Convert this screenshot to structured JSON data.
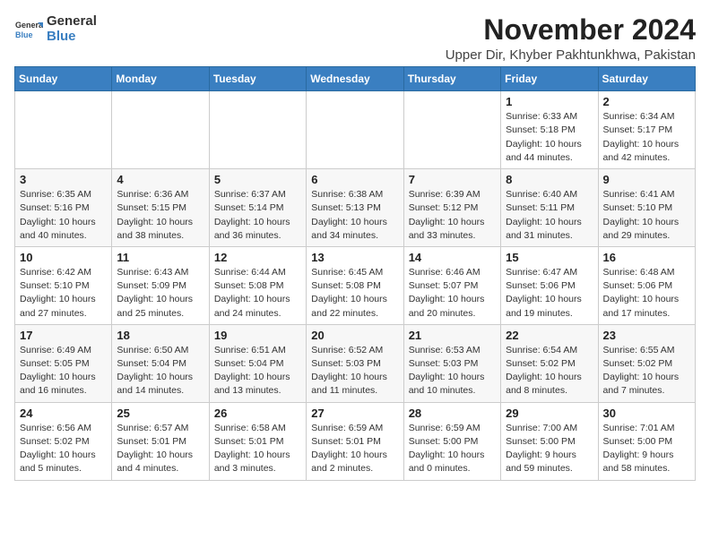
{
  "logo": {
    "name": "General Blue",
    "line1": "General",
    "line2": "Blue"
  },
  "header": {
    "month": "November 2024",
    "location": "Upper Dir, Khyber Pakhtunkhwa, Pakistan"
  },
  "weekdays": [
    "Sunday",
    "Monday",
    "Tuesday",
    "Wednesday",
    "Thursday",
    "Friday",
    "Saturday"
  ],
  "weeks": [
    [
      {
        "day": "",
        "info": ""
      },
      {
        "day": "",
        "info": ""
      },
      {
        "day": "",
        "info": ""
      },
      {
        "day": "",
        "info": ""
      },
      {
        "day": "",
        "info": ""
      },
      {
        "day": "1",
        "info": "Sunrise: 6:33 AM\nSunset: 5:18 PM\nDaylight: 10 hours\nand 44 minutes."
      },
      {
        "day": "2",
        "info": "Sunrise: 6:34 AM\nSunset: 5:17 PM\nDaylight: 10 hours\nand 42 minutes."
      }
    ],
    [
      {
        "day": "3",
        "info": "Sunrise: 6:35 AM\nSunset: 5:16 PM\nDaylight: 10 hours\nand 40 minutes."
      },
      {
        "day": "4",
        "info": "Sunrise: 6:36 AM\nSunset: 5:15 PM\nDaylight: 10 hours\nand 38 minutes."
      },
      {
        "day": "5",
        "info": "Sunrise: 6:37 AM\nSunset: 5:14 PM\nDaylight: 10 hours\nand 36 minutes."
      },
      {
        "day": "6",
        "info": "Sunrise: 6:38 AM\nSunset: 5:13 PM\nDaylight: 10 hours\nand 34 minutes."
      },
      {
        "day": "7",
        "info": "Sunrise: 6:39 AM\nSunset: 5:12 PM\nDaylight: 10 hours\nand 33 minutes."
      },
      {
        "day": "8",
        "info": "Sunrise: 6:40 AM\nSunset: 5:11 PM\nDaylight: 10 hours\nand 31 minutes."
      },
      {
        "day": "9",
        "info": "Sunrise: 6:41 AM\nSunset: 5:10 PM\nDaylight: 10 hours\nand 29 minutes."
      }
    ],
    [
      {
        "day": "10",
        "info": "Sunrise: 6:42 AM\nSunset: 5:10 PM\nDaylight: 10 hours\nand 27 minutes."
      },
      {
        "day": "11",
        "info": "Sunrise: 6:43 AM\nSunset: 5:09 PM\nDaylight: 10 hours\nand 25 minutes."
      },
      {
        "day": "12",
        "info": "Sunrise: 6:44 AM\nSunset: 5:08 PM\nDaylight: 10 hours\nand 24 minutes."
      },
      {
        "day": "13",
        "info": "Sunrise: 6:45 AM\nSunset: 5:08 PM\nDaylight: 10 hours\nand 22 minutes."
      },
      {
        "day": "14",
        "info": "Sunrise: 6:46 AM\nSunset: 5:07 PM\nDaylight: 10 hours\nand 20 minutes."
      },
      {
        "day": "15",
        "info": "Sunrise: 6:47 AM\nSunset: 5:06 PM\nDaylight: 10 hours\nand 19 minutes."
      },
      {
        "day": "16",
        "info": "Sunrise: 6:48 AM\nSunset: 5:06 PM\nDaylight: 10 hours\nand 17 minutes."
      }
    ],
    [
      {
        "day": "17",
        "info": "Sunrise: 6:49 AM\nSunset: 5:05 PM\nDaylight: 10 hours\nand 16 minutes."
      },
      {
        "day": "18",
        "info": "Sunrise: 6:50 AM\nSunset: 5:04 PM\nDaylight: 10 hours\nand 14 minutes."
      },
      {
        "day": "19",
        "info": "Sunrise: 6:51 AM\nSunset: 5:04 PM\nDaylight: 10 hours\nand 13 minutes."
      },
      {
        "day": "20",
        "info": "Sunrise: 6:52 AM\nSunset: 5:03 PM\nDaylight: 10 hours\nand 11 minutes."
      },
      {
        "day": "21",
        "info": "Sunrise: 6:53 AM\nSunset: 5:03 PM\nDaylight: 10 hours\nand 10 minutes."
      },
      {
        "day": "22",
        "info": "Sunrise: 6:54 AM\nSunset: 5:02 PM\nDaylight: 10 hours\nand 8 minutes."
      },
      {
        "day": "23",
        "info": "Sunrise: 6:55 AM\nSunset: 5:02 PM\nDaylight: 10 hours\nand 7 minutes."
      }
    ],
    [
      {
        "day": "24",
        "info": "Sunrise: 6:56 AM\nSunset: 5:02 PM\nDaylight: 10 hours\nand 5 minutes."
      },
      {
        "day": "25",
        "info": "Sunrise: 6:57 AM\nSunset: 5:01 PM\nDaylight: 10 hours\nand 4 minutes."
      },
      {
        "day": "26",
        "info": "Sunrise: 6:58 AM\nSunset: 5:01 PM\nDaylight: 10 hours\nand 3 minutes."
      },
      {
        "day": "27",
        "info": "Sunrise: 6:59 AM\nSunset: 5:01 PM\nDaylight: 10 hours\nand 2 minutes."
      },
      {
        "day": "28",
        "info": "Sunrise: 6:59 AM\nSunset: 5:00 PM\nDaylight: 10 hours\nand 0 minutes."
      },
      {
        "day": "29",
        "info": "Sunrise: 7:00 AM\nSunset: 5:00 PM\nDaylight: 9 hours\nand 59 minutes."
      },
      {
        "day": "30",
        "info": "Sunrise: 7:01 AM\nSunset: 5:00 PM\nDaylight: 9 hours\nand 58 minutes."
      }
    ]
  ]
}
